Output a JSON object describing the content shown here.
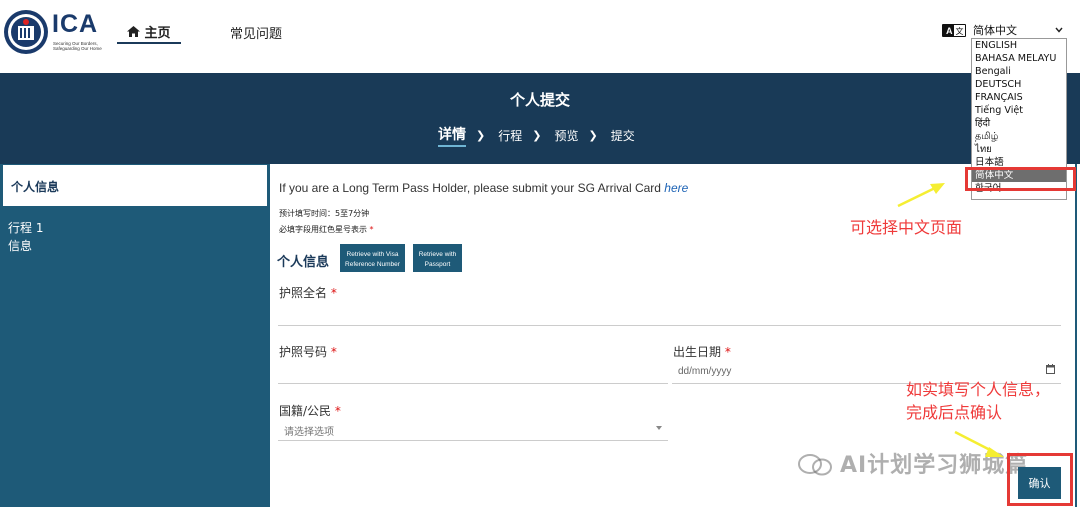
{
  "header": {
    "logo_text": "ICA",
    "logo_tagline_1": "Securing Our Borders,",
    "logo_tagline_2": "Safeguarding Our Home",
    "nav_home": "主页",
    "nav_faq": "常见问题",
    "lang_selected": "简体中文",
    "lang_options": [
      "ENGLISH",
      "BAHASA MELAYU",
      "Bengali",
      "DEUTSCH",
      "FRANÇAIS",
      "Tiếng Việt",
      "हिंदी",
      "தமிழ்",
      "ไทย",
      "日本語",
      "简体中文",
      "한국어"
    ]
  },
  "banner": {
    "title": "个人提交",
    "steps": [
      "详情",
      "行程",
      "预览",
      "提交"
    ]
  },
  "sidebar": {
    "active": "个人信息",
    "item_line1": "行程 1",
    "item_line2": "信息"
  },
  "form": {
    "ltp_note": "If you are a Long Term Pass Holder, please submit your SG Arrival Card ",
    "ltp_link": "here",
    "est_time": "预计填写时间：5至7分钟",
    "required_note": "必填字段用红色星号表示",
    "section_title": "个人信息",
    "btn_visa_1": "Retrieve with Visa",
    "btn_visa_2": "Reference Number",
    "btn_pass_1": "Retrieve with",
    "btn_pass_2": "Passport",
    "label_fullname": "护照全名",
    "label_passport_no": "护照号码",
    "label_dob": "出生日期",
    "dob_placeholder": "dd/mm/yyyy",
    "label_nationality": "国籍/公民",
    "nationality_placeholder": "请选择选项",
    "confirm": "确认"
  },
  "annotations": {
    "note_lang": "可选择中文页面",
    "note_fill_1": "如实填写个人信息，",
    "note_fill_2": "完成后点确认"
  },
  "watermark": "AI计划学习狮城篇",
  "colors": {
    "navy": "#193a57",
    "teal": "#1e5a78",
    "annotation_red": "#e53935",
    "arrow_yellow": "#f5ee32"
  }
}
